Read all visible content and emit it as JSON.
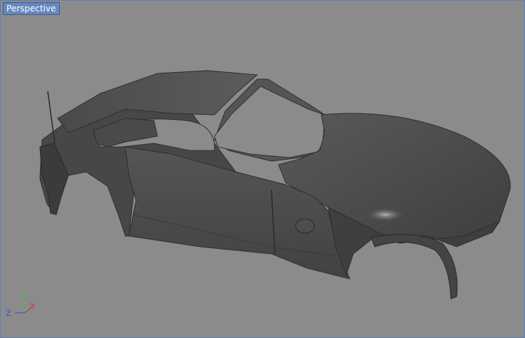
{
  "viewport": {
    "label": "Perspective",
    "accent": "#6688c0",
    "background": "#8b8b8b"
  },
  "axis_gizmo": {
    "x_label": "X",
    "y_label": "Y",
    "z_label": "Z",
    "x_color": "#e03030",
    "y_color": "#30d030",
    "z_color": "#3050e0"
  },
  "model": {
    "name": "car-body-shell",
    "color": "#4b4b4b"
  }
}
